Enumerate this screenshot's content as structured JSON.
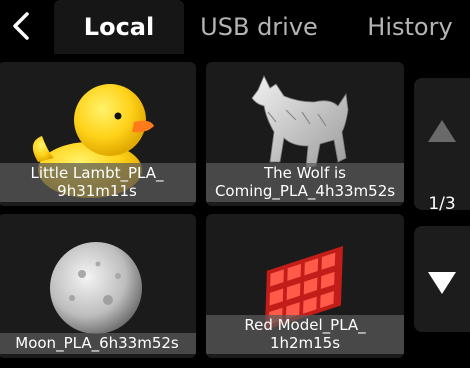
{
  "tabs": [
    {
      "label": "Local",
      "active": true
    },
    {
      "label": "USB drive",
      "active": false
    },
    {
      "label": "History",
      "active": false
    }
  ],
  "back_icon": "chevron-left-icon",
  "files": [
    {
      "name": "Little Lambt_PLA_\n9h31m11s",
      "thumb": "rubber-duck"
    },
    {
      "name": "The Wolf is\nComing_PLA_4h33m52s",
      "thumb": "wolf-statue"
    },
    {
      "name": "Moon_PLA_6h33m52s",
      "thumb": "moon-sphere"
    },
    {
      "name": "Red Model_PLA_\n1h2m15s",
      "thumb": "red-model"
    }
  ],
  "pagination": {
    "indicator": "1/3",
    "up_icon": "triangle-up-icon",
    "down_icon": "triangle-down-icon"
  },
  "colors": {
    "background": "#000000",
    "card": "#1b1b1b",
    "label_bg": "#5a5a5a",
    "accent_red": "#e8302a",
    "duck_yellow": "#ffd21a"
  }
}
